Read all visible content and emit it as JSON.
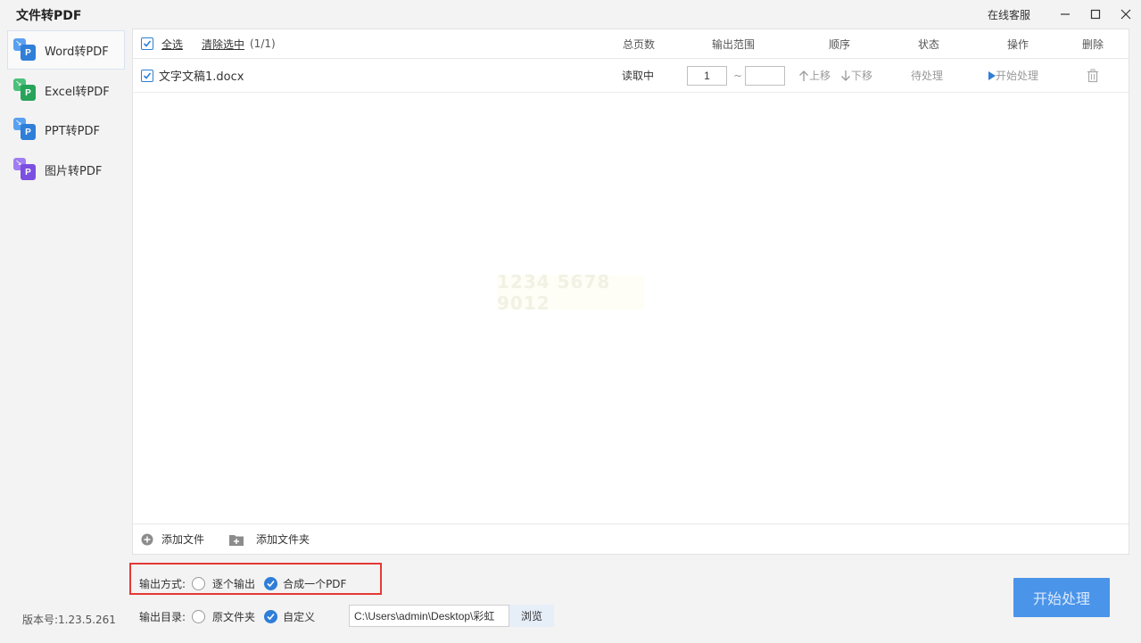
{
  "app": {
    "title": "文件转PDF",
    "support_label": "在线客服"
  },
  "sidebar": {
    "items": [
      {
        "label": "Word转PDF",
        "color": "#2f7ed8",
        "back_color": "#5aa0f0"
      },
      {
        "label": "Excel转PDF",
        "color": "#27a35a",
        "back_color": "#4cc07a"
      },
      {
        "label": "PPT转PDF",
        "color": "#2f7ed8",
        "back_color": "#5aa0f0"
      },
      {
        "label": "图片转PDF",
        "color": "#7b4fe0",
        "back_color": "#a07df0"
      }
    ],
    "icon_letter": "P",
    "version": "版本号:1.23.5.261"
  },
  "table": {
    "select_all": "全选",
    "clear_selection": "清除选中",
    "selection_count": "(1/1)",
    "columns": {
      "total_pages": "总页数",
      "output_range": "输出范围",
      "order": "顺序",
      "status": "状态",
      "action": "操作",
      "delete": "删除"
    },
    "rows": [
      {
        "filename": "文字文稿1.docx",
        "total_pages": "读取中",
        "range_from": "1",
        "range_sep": "~",
        "range_to": "",
        "move_up": "上移",
        "move_down": "下移",
        "status": "待处理",
        "action": "开始处理"
      }
    ],
    "watermark": "1234 5678 9012"
  },
  "footer": {
    "add_file": "添加文件",
    "add_folder": "添加文件夹"
  },
  "options": {
    "output_mode_label": "输出方式:",
    "output_mode_one_by_one": "逐个输出",
    "output_mode_merge": "合成一个PDF",
    "output_dir_label": "输出目录:",
    "output_dir_original": "原文件夹",
    "output_dir_custom": "自定义",
    "output_path": "C:\\Users\\admin\\Desktop\\彩虹",
    "browse": "浏览"
  },
  "start_button": "开始处理",
  "colors": {
    "accent": "#2f7ed8",
    "highlight": "#e53935",
    "start_button": "#4a94ea"
  }
}
